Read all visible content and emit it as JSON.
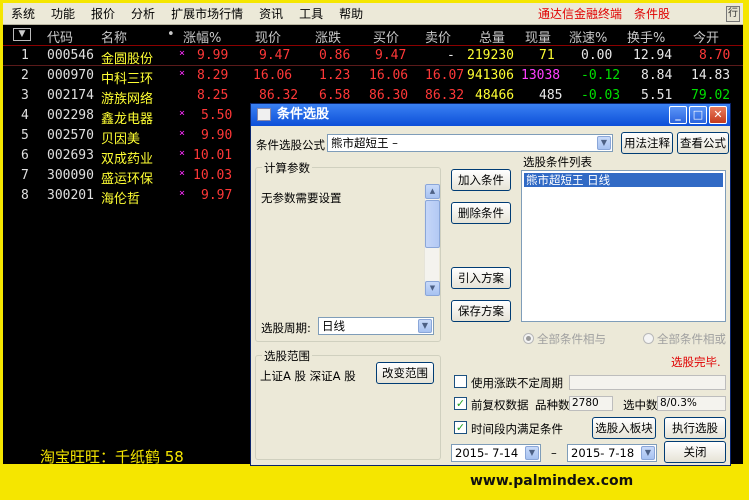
{
  "menu": {
    "items": [
      "系统",
      "功能",
      "报价",
      "分析",
      "扩展市场行情",
      "资讯",
      "工具",
      "帮助"
    ],
    "brand": "通达信金融终端",
    "subtitle": "条件股",
    "mini_button": "行"
  },
  "quote_header": {
    "sort": "▼",
    "columns": [
      "代码",
      "名称",
      "•",
      "涨幅%",
      "现价",
      "涨跌",
      "买价",
      "卖价",
      "总量",
      "现量",
      "涨速%",
      "换手%",
      "今开"
    ]
  },
  "rows": [
    {
      "idx": "1",
      "code": "000546",
      "name": "金圆股份",
      "star": "×",
      "pct": "9.99",
      "price": "9.47",
      "chg": "0.86",
      "bid": "9.47",
      "ask": "-",
      "vol": "219230",
      "cur": "71",
      "speed": "0.00",
      "turn": "12.94",
      "open": "8.70"
    },
    {
      "idx": "2",
      "code": "000970",
      "name": "中科三环",
      "star": "×",
      "pct": "8.29",
      "price": "16.06",
      "chg": "1.23",
      "bid": "16.06",
      "ask": "16.07",
      "vol": "941306",
      "cur": "13038",
      "speed": "-0.12",
      "turn": "8.84",
      "open": "14.83"
    },
    {
      "idx": "3",
      "code": "002174",
      "name": "游族网络",
      "star": "",
      "pct": "8.25",
      "price": "86.32",
      "chg": "6.58",
      "bid": "86.30",
      "ask": "86.32",
      "vol": "48466",
      "cur": "485",
      "speed": "-0.03",
      "turn": "5.51",
      "open": "79.02"
    },
    {
      "idx": "4",
      "code": "002298",
      "name": "鑫龙电器",
      "star": "×",
      "pct": "5.50"
    },
    {
      "idx": "5",
      "code": "002570",
      "name": "贝因美",
      "star": "×",
      "pct": "9.90"
    },
    {
      "idx": "6",
      "code": "002693",
      "name": "双成药业",
      "star": "×",
      "pct": "10.01"
    },
    {
      "idx": "7",
      "code": "300090",
      "name": "盛运环保",
      "star": "×",
      "pct": "10.03"
    },
    {
      "idx": "8",
      "code": "300201",
      "name": "海伦哲",
      "star": "×",
      "pct": "9.97"
    }
  ],
  "footer": {
    "taobao": "淘宝旺旺：千纸鹤 58",
    "watermark": "www.palmindex.com"
  },
  "dialog": {
    "title": "条件选股",
    "formula_label": "条件选股公式",
    "formula_value": "熊市超短王    –",
    "usage_button": "用法注释",
    "view_button": "查看公式",
    "params_group": "计算参数",
    "params_text": "无参数需要设置",
    "period_label": "选股周期:",
    "period_value": "日线",
    "add_button": "加入条件",
    "delete_button": "删除条件",
    "import_button": "引入方案",
    "save_button": "保存方案",
    "list_title": "选股条件列表",
    "list_item": "熊市超短王    日线",
    "radio_and": "全部条件相与",
    "radio_or": "全部条件相或",
    "range_group": "选股范围",
    "range_text": "上证A 股  深证A 股",
    "change_range_button": "改变范围",
    "status": "选股完毕.",
    "use_uncertain": "使用涨跌不定周期",
    "pre_adjust": "前复权数据",
    "variety_label": "品种数",
    "variety_value": "2780",
    "selected_label": "选中数",
    "selected_value": "8/0.3%",
    "time_range": "时间段内满足条件",
    "to_board_button": "选股入板块",
    "run_button": "执行选股",
    "date_from": "2015- 7-14",
    "date_sep": "–",
    "date_to": "2015- 7-18",
    "close_button": "关闭"
  }
}
